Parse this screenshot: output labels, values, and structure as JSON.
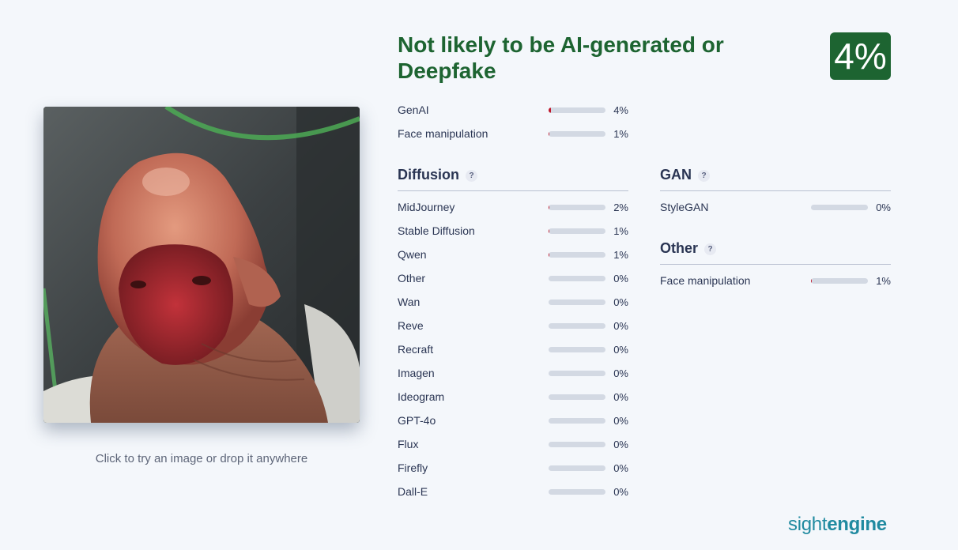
{
  "upload": {
    "hint": "Click to try an image or drop it anywhere"
  },
  "verdict": {
    "title": "Not likely to be AI-generated or Deepfake",
    "score": "4%",
    "color": "#1d6431"
  },
  "summary": [
    {
      "label": "GenAI",
      "percent": "4%",
      "value": 4
    },
    {
      "label": "Face manipulation",
      "percent": "1%",
      "value": 1
    }
  ],
  "diffusion": {
    "title": "Diffusion",
    "help": "?",
    "items": [
      {
        "label": "MidJourney",
        "percent": "2%",
        "value": 2
      },
      {
        "label": "Stable Diffusion",
        "percent": "1%",
        "value": 1
      },
      {
        "label": "Qwen",
        "percent": "1%",
        "value": 1
      },
      {
        "label": "Other",
        "percent": "0%",
        "value": 0
      },
      {
        "label": "Wan",
        "percent": "0%",
        "value": 0
      },
      {
        "label": "Reve",
        "percent": "0%",
        "value": 0
      },
      {
        "label": "Recraft",
        "percent": "0%",
        "value": 0
      },
      {
        "label": "Imagen",
        "percent": "0%",
        "value": 0
      },
      {
        "label": "Ideogram",
        "percent": "0%",
        "value": 0
      },
      {
        "label": "GPT-4o",
        "percent": "0%",
        "value": 0
      },
      {
        "label": "Flux",
        "percent": "0%",
        "value": 0
      },
      {
        "label": "Firefly",
        "percent": "0%",
        "value": 0
      },
      {
        "label": "Dall-E",
        "percent": "0%",
        "value": 0
      }
    ]
  },
  "gan": {
    "title": "GAN",
    "help": "?",
    "items": [
      {
        "label": "StyleGAN",
        "percent": "0%",
        "value": 0
      }
    ]
  },
  "other": {
    "title": "Other",
    "help": "?",
    "items": [
      {
        "label": "Face manipulation",
        "percent": "1%",
        "value": 1
      }
    ]
  },
  "brand": {
    "light": "sight",
    "bold": "engine",
    "color": "#208aa0"
  },
  "colors": {
    "bar_track": "#d3d9e3",
    "bar_fill": "#c0172b"
  }
}
